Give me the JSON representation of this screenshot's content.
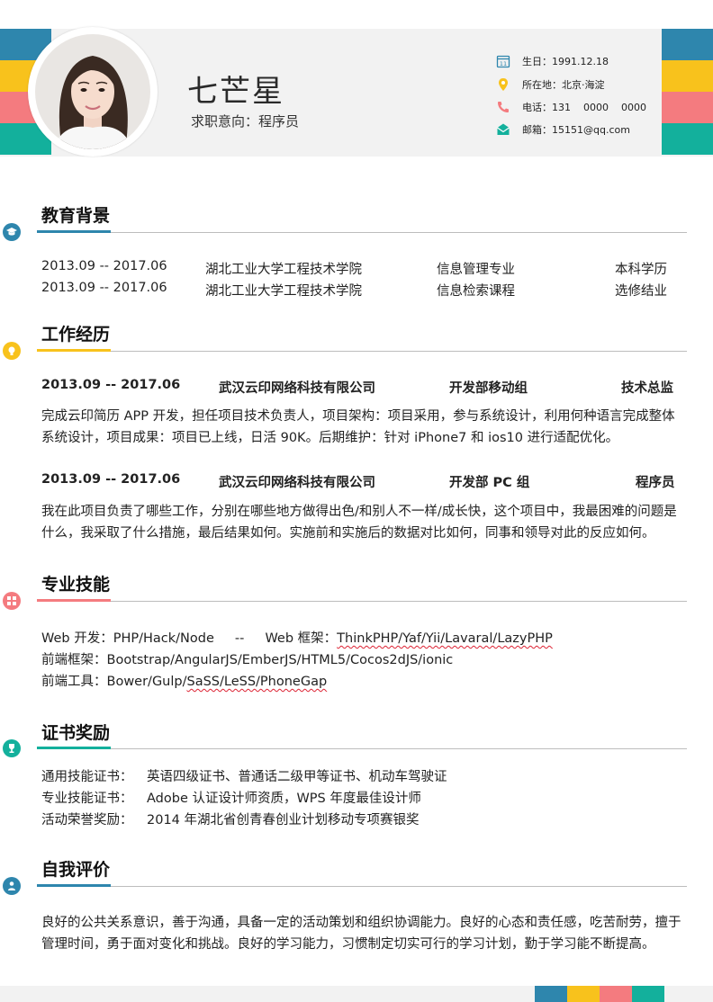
{
  "header": {
    "name": "七芒星",
    "job_intent": "求职意向：程序员",
    "contacts": [
      {
        "icon": "calendar-icon",
        "text": "生日：1991.12.18"
      },
      {
        "icon": "location-pin-icon",
        "text": "所在地：北京·海淀"
      },
      {
        "icon": "phone-icon",
        "text": "电话：131    0000    0000"
      },
      {
        "icon": "mail-icon",
        "text": "邮箱：15151@qq.com"
      }
    ]
  },
  "colors": {
    "blue": "#2e86ad",
    "yellow": "#f8c21c",
    "pink": "#f47b7f",
    "teal": "#13b09c"
  },
  "education": {
    "title": "教育背景",
    "icon": "graduation-cap-icon",
    "rows": [
      {
        "date": "2013.09 -- 2017.06",
        "school": "湖北工业大学工程技术学院",
        "major": "信息管理专业",
        "degree": "本科学历"
      },
      {
        "date": "2013.09 -- 2017.06",
        "school": "湖北工业大学工程技术学院",
        "major": "信息检索课程",
        "degree": "选修结业"
      }
    ]
  },
  "work": {
    "title": "工作经历",
    "icon": "lightbulb-icon",
    "jobs": [
      {
        "date": "2013.09 -- 2017.06",
        "company": "武汉云印网络科技有限公司",
        "dept": "开发部移动组",
        "role": "技术总监",
        "desc": "完成云印简历 APP 开发，担任项目技术负责人，项目架构：项目采用，参与系统设计，利用何种语言完成整体系统设计，项目成果：项目已上线，日活 90K。后期维护：针对 iPhone7 和 ios10 进行适配优化。"
      },
      {
        "date": "2013.09 -- 2017.06",
        "company": "武汉云印网络科技有限公司",
        "dept": "开发部 PC 组",
        "role": "程序员",
        "desc": "我在此项目负责了哪些工作，分别在哪些地方做得出色/和别人不一样/成长快，这个项目中，我最困难的问题是什么，我采取了什么措施，最后结果如何。实施前和实施后的数据对比如何，同事和领导对此的反应如何。"
      }
    ]
  },
  "skills": {
    "title": "专业技能",
    "icon": "grid-icon",
    "line1_prefix": "Web 开发：PHP/Hack/Node     --     Web 框架：",
    "line1_wavy": "ThinkPHP/Yaf/Yii/Lavaral/LazyPHP",
    "line2": "前端框架：Bootstrap/AngularJS/EmberJS/HTML5/Cocos2dJS/ionic",
    "line3_prefix": "前端工具：Bower/Gulp/",
    "line3_wavy": "SaSS/LeSS/PhoneGap"
  },
  "awards": {
    "title": "证书奖励",
    "icon": "trophy-icon",
    "rows": [
      {
        "label": "通用技能证书：",
        "value": "英语四级证书、普通话二级甲等证书、机动车驾驶证"
      },
      {
        "label": "专业技能证书：",
        "value": "Adobe 认证设计师资质，WPS 年度最佳设计师"
      },
      {
        "label": "活动荣誉奖励：",
        "value": "2014 年湖北省创青春创业计划移动专项赛银奖"
      }
    ]
  },
  "self": {
    "title": "自我评价",
    "icon": "person-icon",
    "text": "良好的公共关系意识，善于沟通，具备一定的活动策划和组织协调能力。良好的心态和责任感，吃苦耐劳，擅于管理时间，勇于面对变化和挑战。良好的学习能力，习惯制定切实可行的学习计划，勤于学习能不断提高。"
  }
}
